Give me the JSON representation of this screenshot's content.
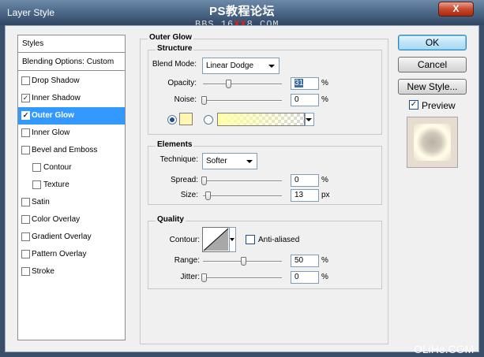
{
  "window": {
    "title": "Layer Style",
    "close_label": "X",
    "watermark": "PS教程论坛",
    "watermark_url_pre": "BBS.16",
    "watermark_url_red": "XX",
    "watermark_url_post": "8.COM",
    "footer_watermark": "OLiHe.COM"
  },
  "sidebar": {
    "header": "Styles",
    "blending": "Blending Options: Custom",
    "items": [
      {
        "label": "Drop Shadow",
        "checked": false
      },
      {
        "label": "Inner Shadow",
        "checked": true
      },
      {
        "label": "Outer Glow",
        "checked": true,
        "selected": true
      },
      {
        "label": "Inner Glow",
        "checked": false
      },
      {
        "label": "Bevel and Emboss",
        "checked": false
      },
      {
        "label": "Contour",
        "checked": false,
        "sub": true
      },
      {
        "label": "Texture",
        "checked": false,
        "sub": true
      },
      {
        "label": "Satin",
        "checked": false
      },
      {
        "label": "Color Overlay",
        "checked": false
      },
      {
        "label": "Gradient Overlay",
        "checked": false
      },
      {
        "label": "Pattern Overlay",
        "checked": false
      },
      {
        "label": "Stroke",
        "checked": false
      }
    ]
  },
  "panel": {
    "title": "Outer Glow",
    "structure": {
      "title": "Structure",
      "blend_mode_label": "Blend Mode:",
      "blend_mode": "Linear Dodge",
      "opacity_label": "Opacity:",
      "opacity": "31",
      "opacity_pct": 31,
      "noise_label": "Noise:",
      "noise": "0",
      "noise_pct": 0,
      "unit": "%",
      "glow_color": "#fff7b0",
      "gradient_start": "#ffffa8"
    },
    "elements": {
      "title": "Elements",
      "technique_label": "Technique:",
      "technique": "Softer",
      "spread_label": "Spread:",
      "spread": "0",
      "spread_pct": 0,
      "size_label": "Size:",
      "size": "13",
      "size_frac": 0.05,
      "pct": "%",
      "px": "px"
    },
    "quality": {
      "title": "Quality",
      "contour_label": "Contour:",
      "anti_aliased": "Anti-aliased",
      "range_label": "Range:",
      "range": "50",
      "range_pct": 50,
      "jitter_label": "Jitter:",
      "jitter": "0",
      "jitter_pct": 0,
      "unit": "%"
    }
  },
  "buttons": {
    "ok": "OK",
    "cancel": "Cancel",
    "new_style": "New Style...",
    "preview": "Preview"
  }
}
